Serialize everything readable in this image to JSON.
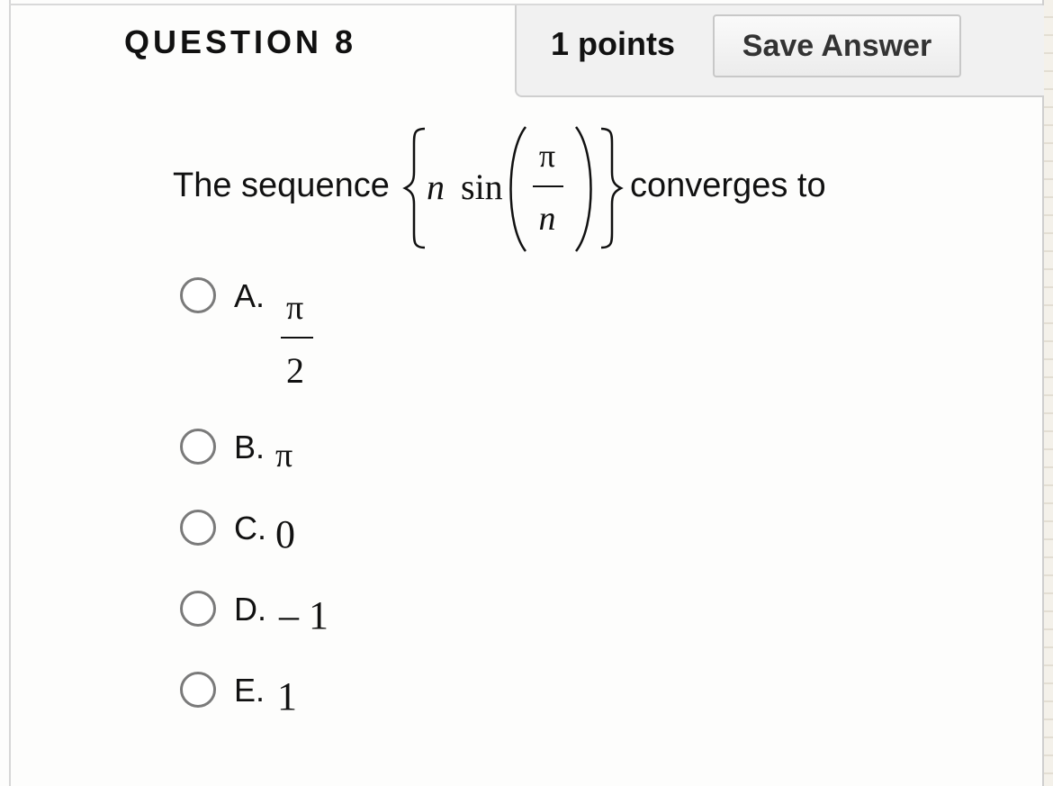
{
  "question": {
    "title": "QUESTION 8",
    "points": "1 points",
    "save_label": "Save Answer"
  },
  "stem": {
    "prefix": "The sequence",
    "suffix": "converges to",
    "math_n": "n",
    "math_sin": "sin",
    "math_num": "π",
    "math_den": "n"
  },
  "options": [
    {
      "letter": "A.",
      "numerator": "π",
      "denominator": "2"
    },
    {
      "letter": "B.",
      "value": "π"
    },
    {
      "letter": "C.",
      "value": "0"
    },
    {
      "letter": "D.",
      "value": "– 1"
    },
    {
      "letter": "E.",
      "value": "1"
    }
  ]
}
